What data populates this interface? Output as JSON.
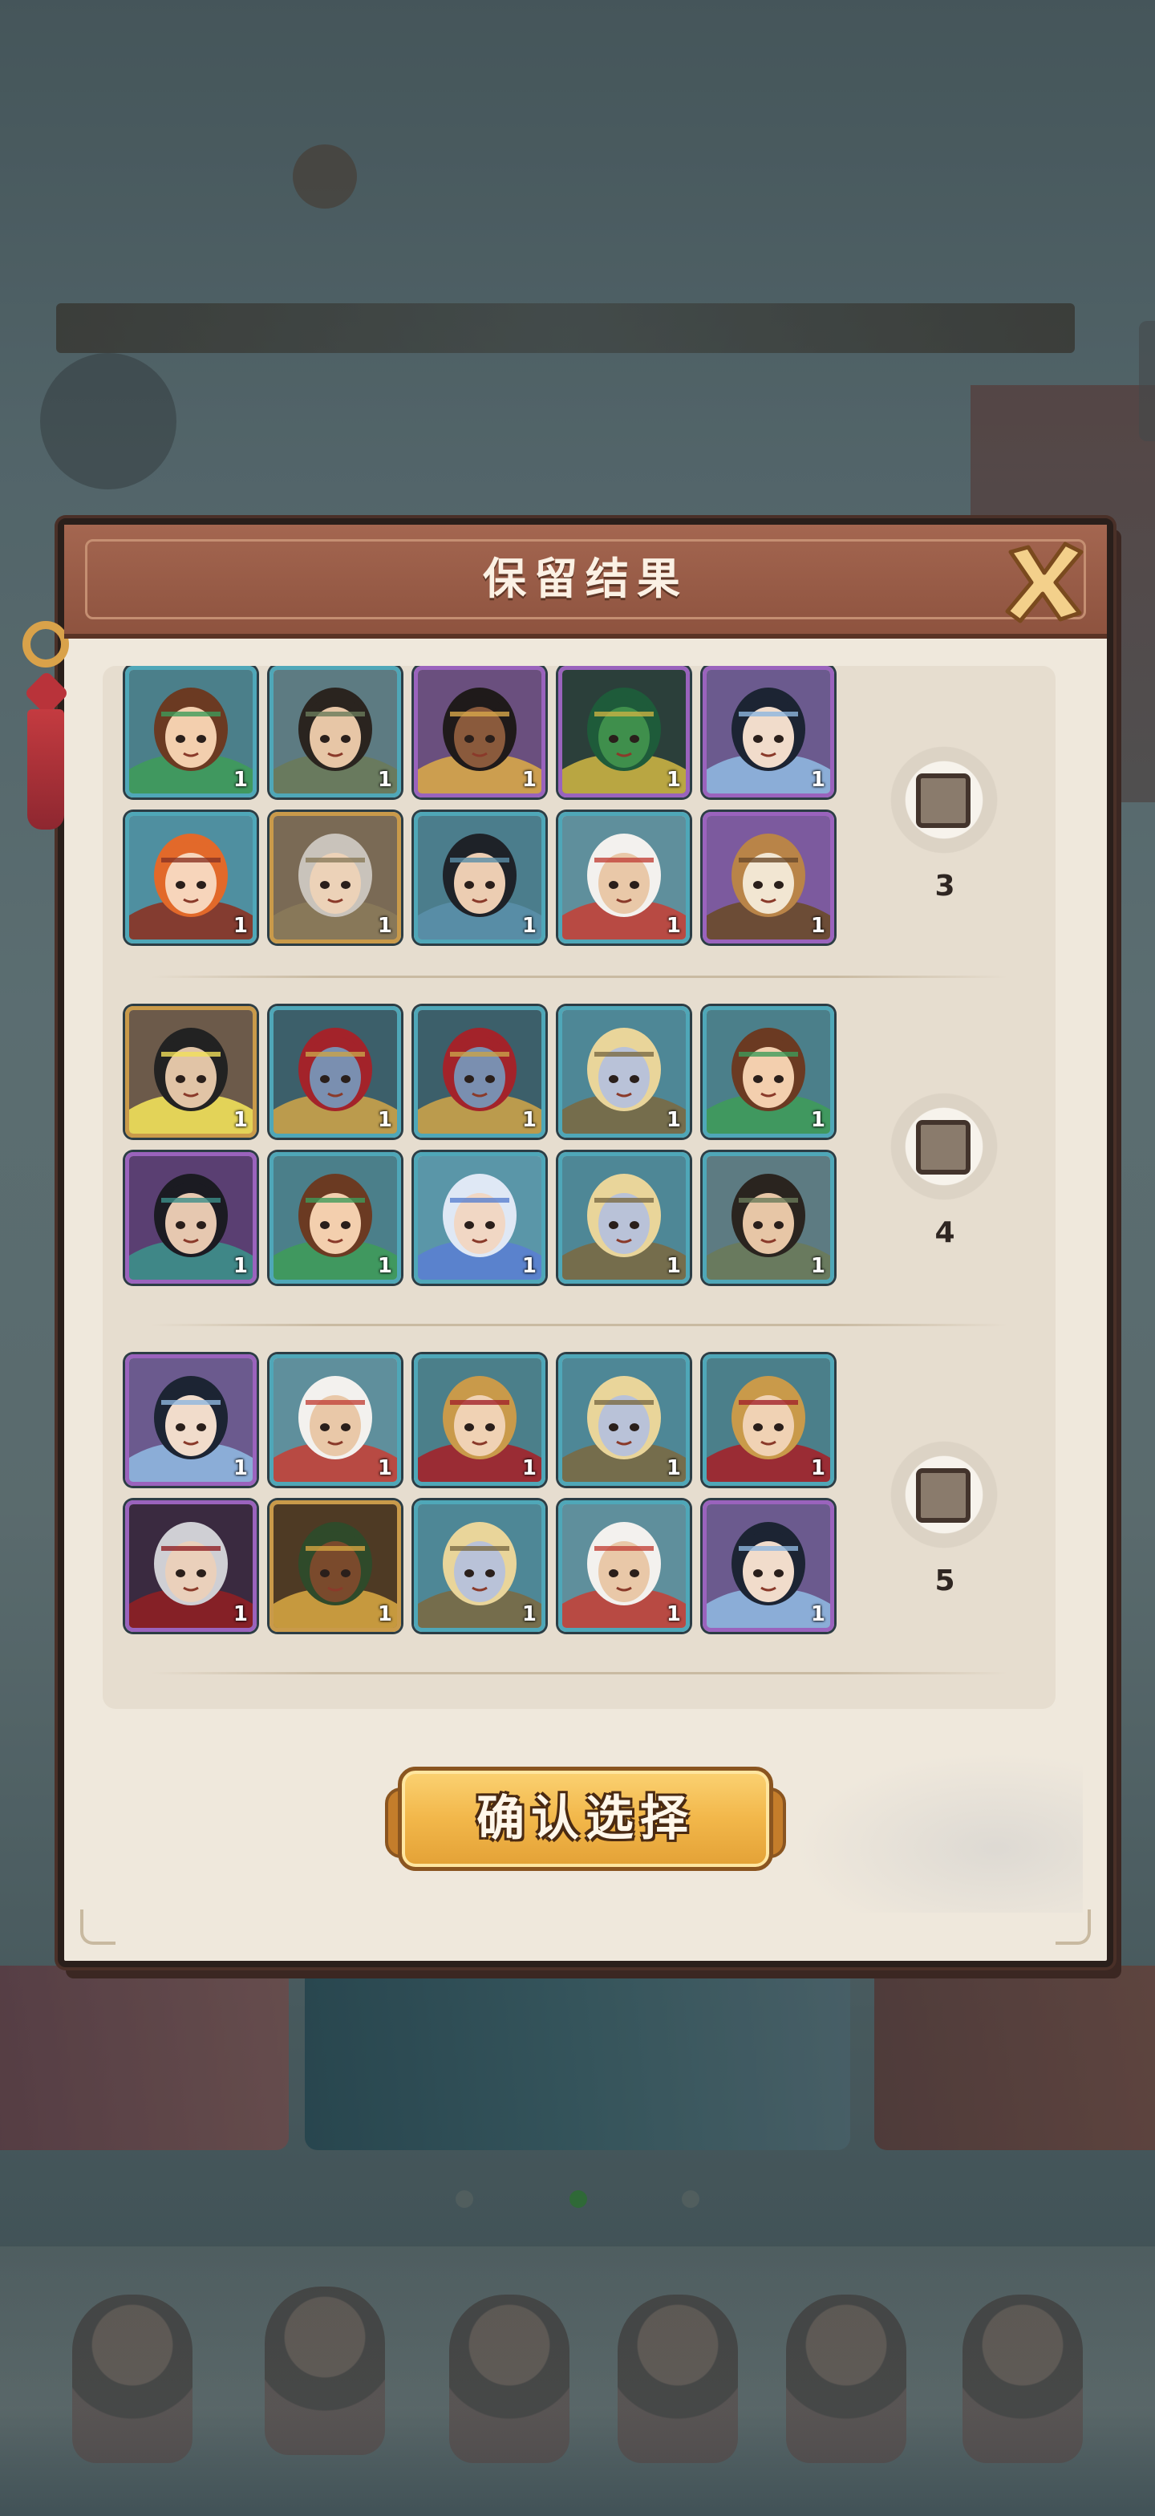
{
  "dialog": {
    "title": "保留结果",
    "confirm_label": "确认选择"
  },
  "groups": [
    {
      "count": "3",
      "heroes": [
        {
          "portrait": "green-headband-brown-hair-girl-icon",
          "level": "1",
          "frame": "blue"
        },
        {
          "portrait": "dark-hair-swordsman-icon",
          "level": "1",
          "frame": "blue"
        },
        {
          "portrait": "dark-skin-priestess-icon",
          "level": "1",
          "frame": "purple"
        },
        {
          "portrait": "green-dragon-beast-icon",
          "level": "1",
          "frame": "purple"
        },
        {
          "portrait": "black-hair-scholar-icon",
          "level": "1",
          "frame": "purple"
        },
        {
          "portrait": "orange-hair-girl-icon",
          "level": "1",
          "frame": "blue"
        },
        {
          "portrait": "silver-hair-man-icon",
          "level": "1",
          "frame": "gold"
        },
        {
          "portrait": "dark-hair-young-man-icon",
          "level": "1",
          "frame": "blue"
        },
        {
          "portrait": "white-hair-tiger-girl-icon",
          "level": "1",
          "frame": "blue"
        },
        {
          "portrait": "deer-spirit-icon",
          "level": "1",
          "frame": "purple"
        }
      ]
    },
    {
      "count": "4",
      "heroes": [
        {
          "portrait": "armored-lightning-general-icon",
          "level": "1",
          "frame": "gold"
        },
        {
          "portrait": "red-beard-warrior-icon",
          "level": "1",
          "frame": "blue"
        },
        {
          "portrait": "red-beard-warrior-icon",
          "level": "1",
          "frame": "blue"
        },
        {
          "portrait": "blonde-pale-lady-icon",
          "level": "1",
          "frame": "blue"
        },
        {
          "portrait": "green-headband-brown-hair-girl-icon",
          "level": "1",
          "frame": "blue"
        },
        {
          "portrait": "black-hair-assassin-icon",
          "level": "1",
          "frame": "purple"
        },
        {
          "portrait": "green-headband-brown-hair-girl-icon",
          "level": "1",
          "frame": "blue"
        },
        {
          "portrait": "blue-hair-fox-girl-icon",
          "level": "1",
          "frame": "blue"
        },
        {
          "portrait": "blonde-pale-lady-icon",
          "level": "1",
          "frame": "blue"
        },
        {
          "portrait": "dark-hair-swordsman-icon",
          "level": "1",
          "frame": "blue"
        }
      ]
    },
    {
      "count": "5",
      "heroes": [
        {
          "portrait": "black-hair-scholar-icon",
          "level": "1",
          "frame": "purple"
        },
        {
          "portrait": "white-hair-tiger-girl-icon",
          "level": "1",
          "frame": "blue"
        },
        {
          "portrait": "golden-hair-prince-icon",
          "level": "1",
          "frame": "blue"
        },
        {
          "portrait": "blonde-pale-lady-icon",
          "level": "1",
          "frame": "blue"
        },
        {
          "portrait": "golden-hair-prince-icon",
          "level": "1",
          "frame": "blue"
        },
        {
          "portrait": "silver-hair-red-cloak-icon",
          "level": "1",
          "frame": "purple"
        },
        {
          "portrait": "dark-skin-masked-girl-icon",
          "level": "1",
          "frame": "gold"
        },
        {
          "portrait": "blonde-pale-lady-icon",
          "level": "1",
          "frame": "blue"
        },
        {
          "portrait": "white-hair-tiger-girl-icon",
          "level": "1",
          "frame": "blue"
        },
        {
          "portrait": "black-hair-scholar-icon",
          "level": "1",
          "frame": "purple"
        }
      ]
    }
  ],
  "colors": {
    "frame_blue": "#4fa7b8",
    "frame_purple": "#9a63bd",
    "frame_gold": "#c99a4a",
    "header": "#9a5c47",
    "confirm_button": "#f2b74a"
  }
}
